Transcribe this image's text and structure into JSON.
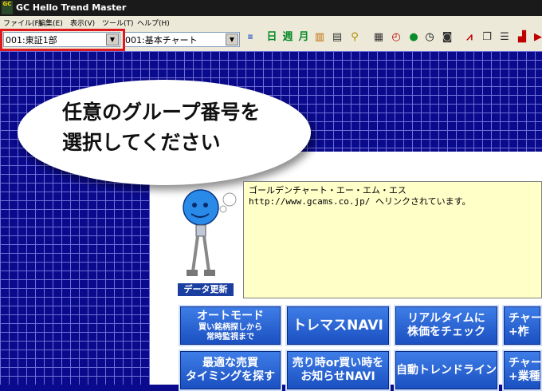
{
  "window": {
    "title": "GC Hello Trend Master",
    "logo": "GC"
  },
  "menu": [
    "ファイル(F)",
    "編集(E)",
    "表示(V)",
    "ツール(T)",
    "ヘルプ(H)"
  ],
  "toolbar": {
    "group_select": "001:東証1部",
    "chart_select": "001:基本チャート",
    "period_day": "日",
    "period_week": "週",
    "period_month": "月"
  },
  "callout": {
    "line1": "任意のグループ番号を",
    "line2": "選択してください"
  },
  "message": {
    "line1": "ゴールデンチャート・エー・エム・エス",
    "line2": "http://www.gcams.co.jp/ へリンクされています。"
  },
  "data_update_label": "データ更新",
  "buttons": {
    "auto_mode_title": "オートモード",
    "auto_mode_sub1": "買い銘柄探しから",
    "auto_mode_sub2": "常時監視まで",
    "tremas_navi": "トレマスNAVI",
    "realtime_line1": "リアルタイムに",
    "realtime_line2": "株価をチェック",
    "chart_partial1_l1": "チャー",
    "chart_partial1_l2": "+柞",
    "timing_line1": "最適な売買",
    "timing_line2": "タイミングを探す",
    "sell_buy_line1": "売り時or買い時を",
    "sell_buy_line2": "お知らせNAVI",
    "auto_trendline": "自動トレンドライン",
    "chart_partial2_l1": "チャー",
    "chart_partial2_l2": "+業種"
  }
}
